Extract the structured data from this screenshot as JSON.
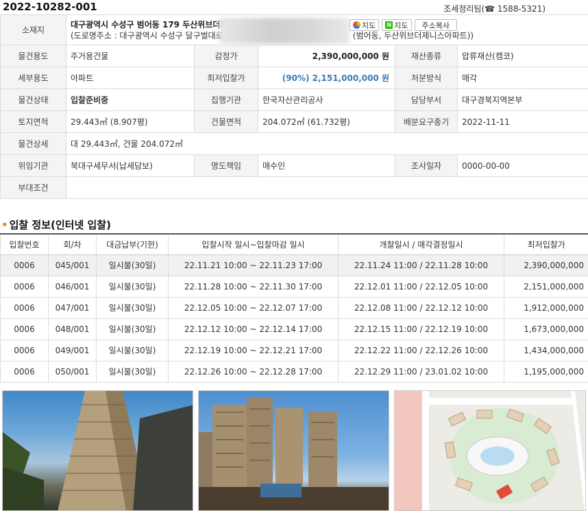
{
  "header": {
    "case_no": "2022-10282-001",
    "team": "조세정리팀(☎ 1588-5321)"
  },
  "address": {
    "label": "소재지",
    "line1": "대구광역시 수성구 범어동 179 두산위브더제니",
    "line2_prefix": "(도로명주소 : 대구광역시 수성구 달구벌대로 24",
    "line2_suffix": "(범어동, 두산위브더제니스아파트))",
    "btn_kakao": "지도",
    "btn_naver": "지도",
    "btn_copy": "주소복사"
  },
  "info": {
    "r1": {
      "l1": "물건용도",
      "v1": "주거용건물",
      "l2": "감정가",
      "v2": "2,390,000,000 원",
      "l3": "재산종류",
      "v3": "압류재산(캠코)"
    },
    "r2": {
      "l1": "세부용도",
      "v1": "아파트",
      "l2": "최저입찰가",
      "v2": "(90%) 2,151,000,000 원",
      "l3": "처분방식",
      "v3": "매각"
    },
    "r3": {
      "l1": "물건상태",
      "v1": "입찰준비중",
      "l2": "집행기관",
      "v2": "한국자산관리공사",
      "l3": "담당부서",
      "v3": "대구경북지역본부"
    },
    "r4": {
      "l1": "토지면적",
      "v1": "29.443㎡ (8.907평)",
      "l2": "건물면적",
      "v2": "204.072㎡ (61.732평)",
      "l3": "배분요구종기",
      "v3": "2022-11-11"
    },
    "r5": {
      "l1": "물건상세",
      "v1": "대 29.443㎡, 건물 204.072㎡"
    },
    "r6": {
      "l1": "위임기관",
      "v1": "북대구세무서(납세담보)",
      "l2": "명도책임",
      "v2": "매수인",
      "l3": "조사일자",
      "v3": "0000-00-00"
    },
    "r7": {
      "l1": "부대조건",
      "v1": ""
    }
  },
  "bid_section": {
    "title": "입찰 정보(인터넷 입찰)",
    "headers": [
      "입찰번호",
      "회/차",
      "대금납부(기한)",
      "입찰시작 일시~입찰마감 일시",
      "개찰일시 / 매각결정일시",
      "최저입찰가"
    ],
    "rows": [
      [
        "0006",
        "045/001",
        "일시불(30일)",
        "22.11.21 10:00 ~ 22.11.23 17:00",
        "22.11.24 11:00 / 22.11.28 10:00",
        "2,390,000,000"
      ],
      [
        "0006",
        "046/001",
        "일시불(30일)",
        "22.11.28 10:00 ~ 22.11.30 17:00",
        "22.12.01 11:00 / 22.12.05 10:00",
        "2,151,000,000"
      ],
      [
        "0006",
        "047/001",
        "일시불(30일)",
        "22.12.05 10:00 ~ 22.12.07 17:00",
        "22.12.08 11:00 / 22.12.12 10:00",
        "1,912,000,000"
      ],
      [
        "0006",
        "048/001",
        "일시불(30일)",
        "22.12.12 10:00 ~ 22.12.14 17:00",
        "22.12.15 11:00 / 22.12.19 10:00",
        "1,673,000,000"
      ],
      [
        "0006",
        "049/001",
        "일시불(30일)",
        "22.12.19 10:00 ~ 22.12.21 17:00",
        "22.12.22 11:00 / 22.12.26 10:00",
        "1,434,000,000"
      ],
      [
        "0006",
        "050/001",
        "일시불(30일)",
        "22.12.26 10:00 ~ 22.12.28 17:00",
        "22.12.29 11:00 / 23.01.02 10:00",
        "1,195,000,000"
      ]
    ]
  },
  "photos": {
    "icons": [
      "building-photo",
      "skyline-photo",
      "site-map-image"
    ]
  }
}
